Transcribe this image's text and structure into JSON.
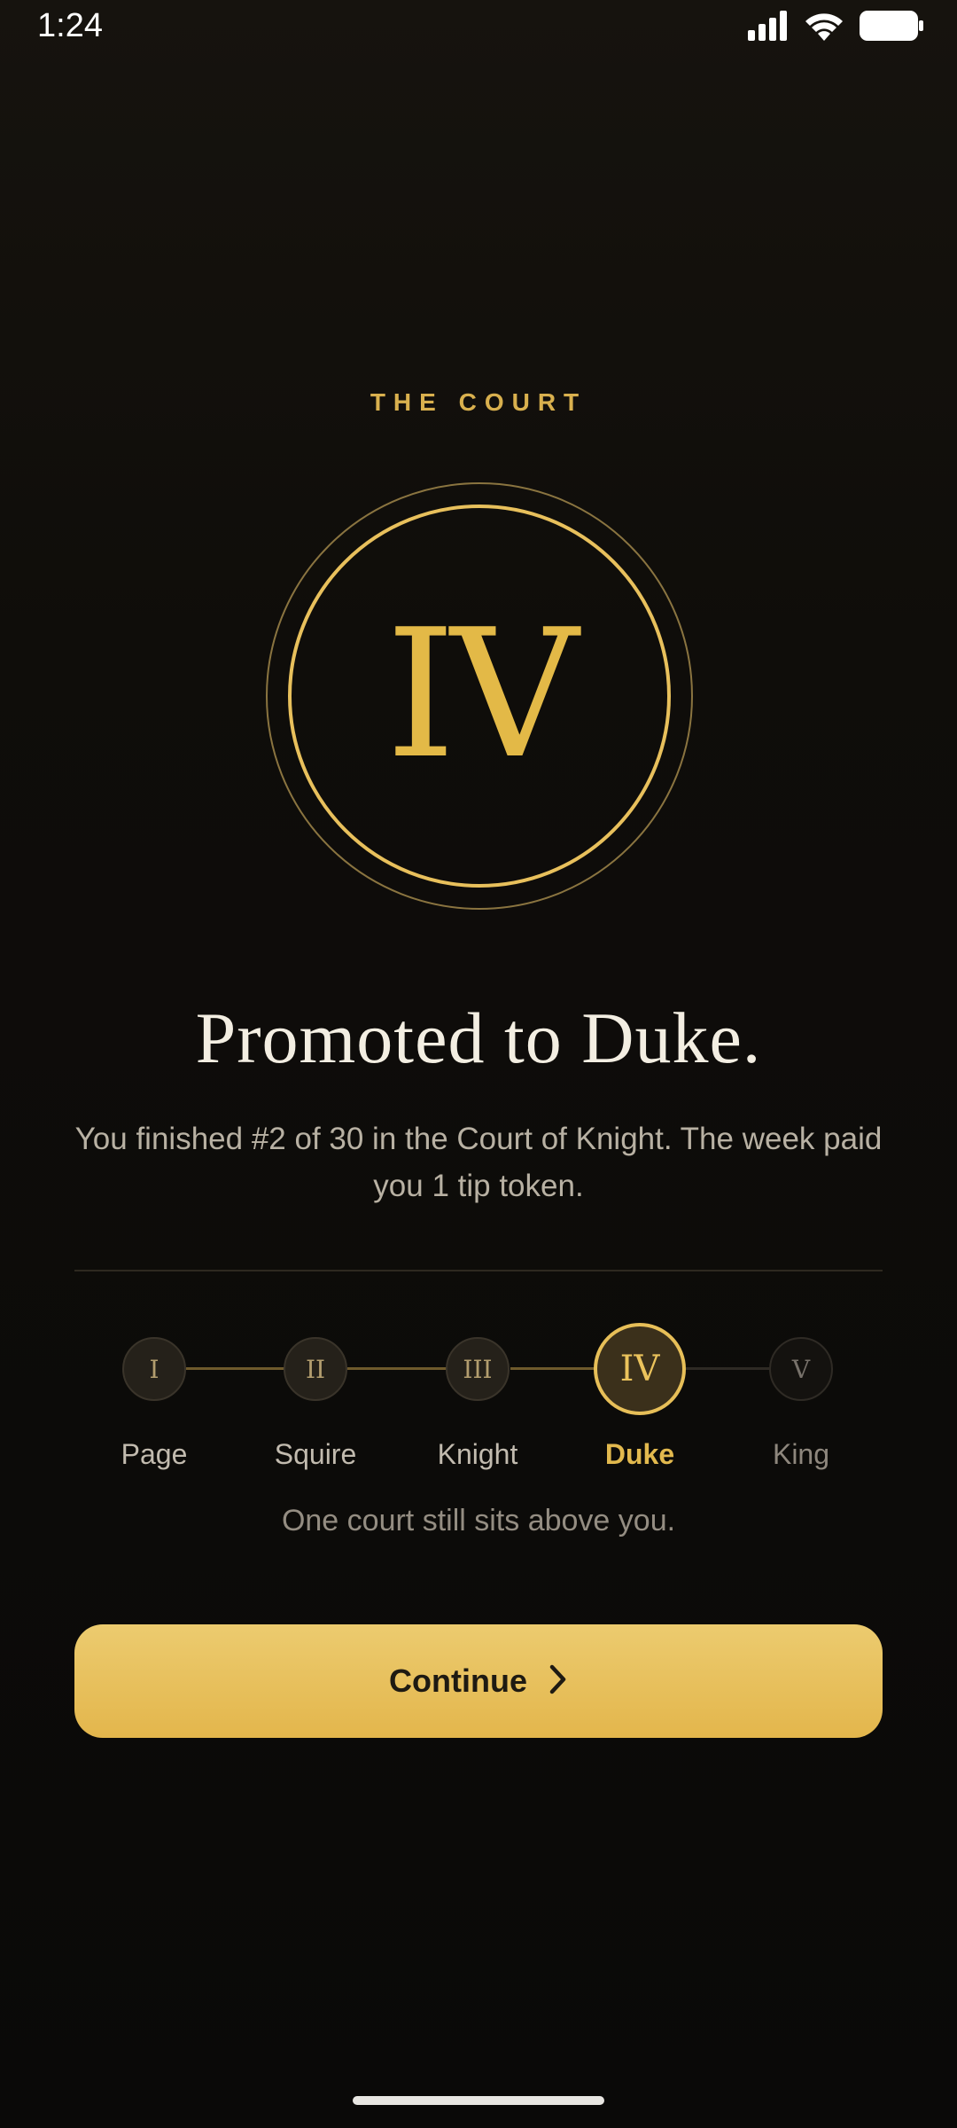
{
  "status_bar": {
    "time": "1:24"
  },
  "eyebrow": "THE COURT",
  "emblem": {
    "numeral": "IV"
  },
  "headline": "Promoted to Duke.",
  "subtext": "You finished #2 of 30 in the Court of Knight. The week paid you 1 tip token.",
  "ranks": [
    {
      "numeral": "I",
      "label": "Page",
      "state": "past"
    },
    {
      "numeral": "II",
      "label": "Squire",
      "state": "past"
    },
    {
      "numeral": "III",
      "label": "Knight",
      "state": "past"
    },
    {
      "numeral": "IV",
      "label": "Duke",
      "state": "current"
    },
    {
      "numeral": "V",
      "label": "King",
      "state": "future"
    }
  ],
  "track_caption": "One court still sits above you.",
  "continue_button": {
    "label": "Continue",
    "icon": "chevron-right-icon"
  },
  "colors": {
    "accent_gold": "#e3b947",
    "background": "#0f0d0a",
    "headline": "#f3eee2"
  }
}
